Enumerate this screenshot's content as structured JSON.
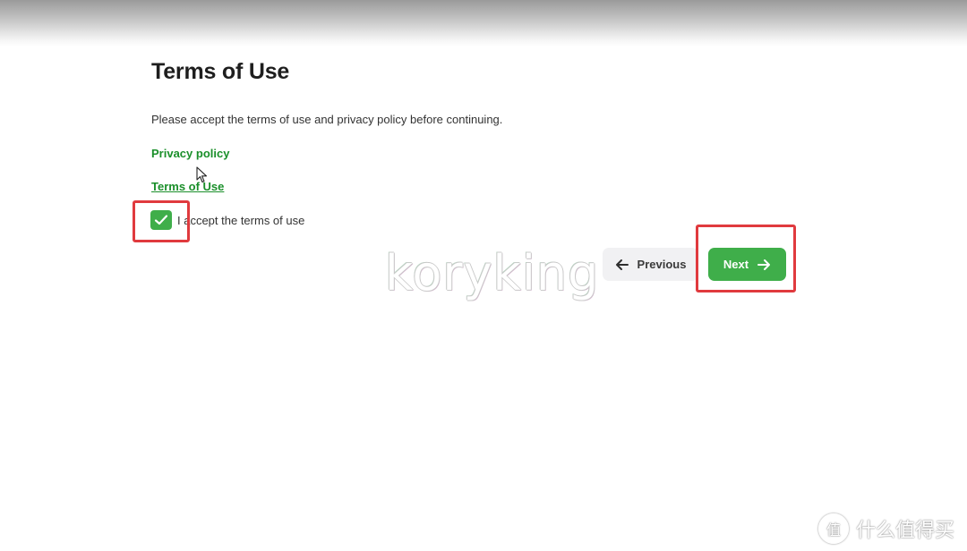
{
  "page": {
    "title": "Terms of Use",
    "intro": "Please accept the terms of use and privacy policy before continuing."
  },
  "links": {
    "privacy": "Privacy policy",
    "terms": "Terms of Use"
  },
  "checkbox": {
    "label": "I accept the terms of use",
    "checked": true
  },
  "buttons": {
    "previous": "Previous",
    "next": "Next"
  },
  "watermark": {
    "text": "koryking"
  },
  "corner_logo": {
    "badge": "值",
    "text": "什么值得买"
  },
  "colors": {
    "accent_green": "#3fae4a",
    "link_green": "#1a8f2a",
    "highlight_red": "#e03a3e"
  }
}
